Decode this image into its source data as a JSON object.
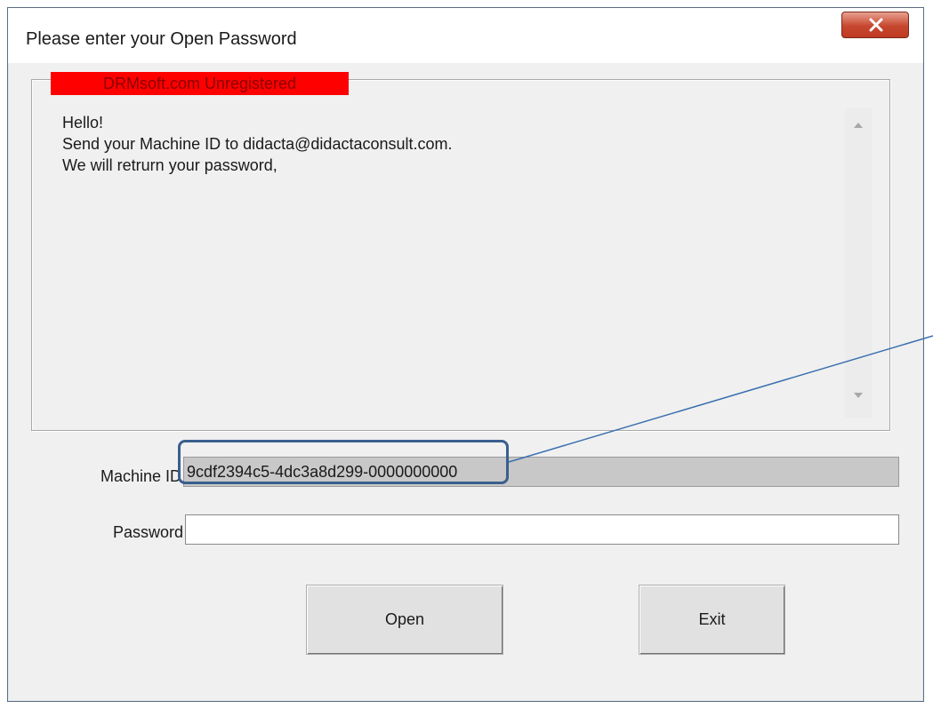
{
  "window": {
    "title": "Please enter your Open Password",
    "close_icon": "close-icon"
  },
  "registration": {
    "label": "DRMsoft.com Unregistered",
    "color": "#ff0000"
  },
  "message": {
    "lines": [
      "Hello!",
      "Send your Machine ID to didacta@didactaconsult.com.",
      "We will retrurn your password,"
    ]
  },
  "machine_id": {
    "label": "Machine ID",
    "value": "9cdf2394c5-4dc3a8d299-0000000000"
  },
  "password": {
    "label": "Password",
    "value": ""
  },
  "buttons": {
    "open_label": "Open",
    "exit_label": "Exit"
  }
}
